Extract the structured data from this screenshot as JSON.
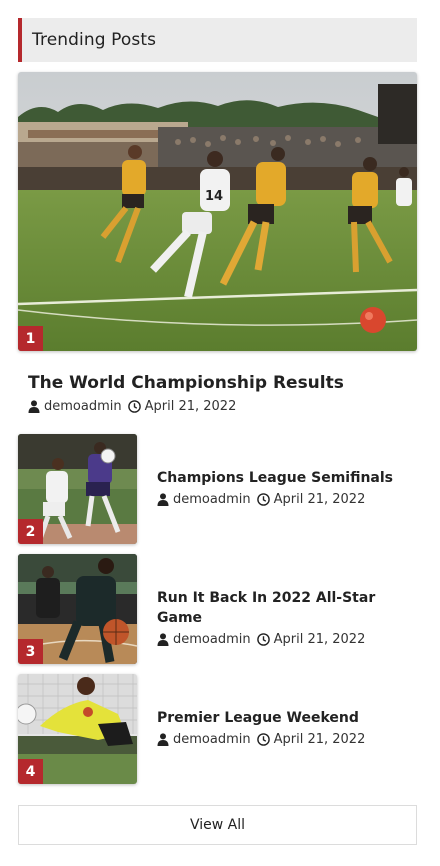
{
  "widget": {
    "title": "Trending Posts",
    "accent_color": "#b5292d"
  },
  "featured": {
    "rank": "1",
    "title": "The World Championship Results",
    "author": "demoadmin",
    "date": "April 21, 2022",
    "image": "soccer-match-photo"
  },
  "posts": [
    {
      "rank": "2",
      "title": "Champions League Semifinals",
      "author": "demoadmin",
      "date": "April 21, 2022",
      "image": "soccer-players-photo"
    },
    {
      "rank": "3",
      "title": "Run It Back In 2022 All-Star Game",
      "author": "demoadmin",
      "date": "April 21, 2022",
      "image": "basketball-photo"
    },
    {
      "rank": "4",
      "title": "Premier League Weekend",
      "author": "demoadmin",
      "date": "April 21, 2022",
      "image": "goalkeeper-save-photo"
    }
  ],
  "view_all_label": "View All",
  "icons": {
    "author": "user-icon",
    "date": "clock-icon"
  }
}
